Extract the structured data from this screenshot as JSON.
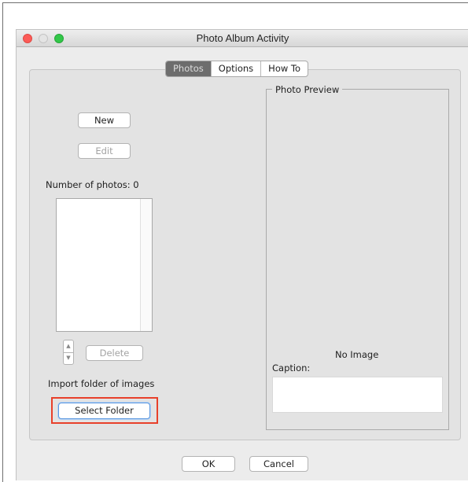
{
  "window": {
    "title": "Photo Album Activity"
  },
  "tabs": [
    {
      "label": "Photos",
      "active": true
    },
    {
      "label": "Options",
      "active": false
    },
    {
      "label": "How To",
      "active": false
    }
  ],
  "photos_tab": {
    "new_label": "New",
    "edit_label": "Edit",
    "count_label": "Number of photos: 0",
    "delete_label": "Delete",
    "import_label": "Import folder of images",
    "select_folder_label": "Select Folder"
  },
  "preview": {
    "legend": "Photo Preview",
    "no_image": "No Image",
    "caption_label": "Caption:",
    "caption_value": ""
  },
  "footer": {
    "ok_label": "OK",
    "cancel_label": "Cancel"
  },
  "colors": {
    "highlight": "#e8402a",
    "close": "#fc5b57",
    "maximize": "#32c748",
    "active_tab": "#6d6d6d"
  }
}
